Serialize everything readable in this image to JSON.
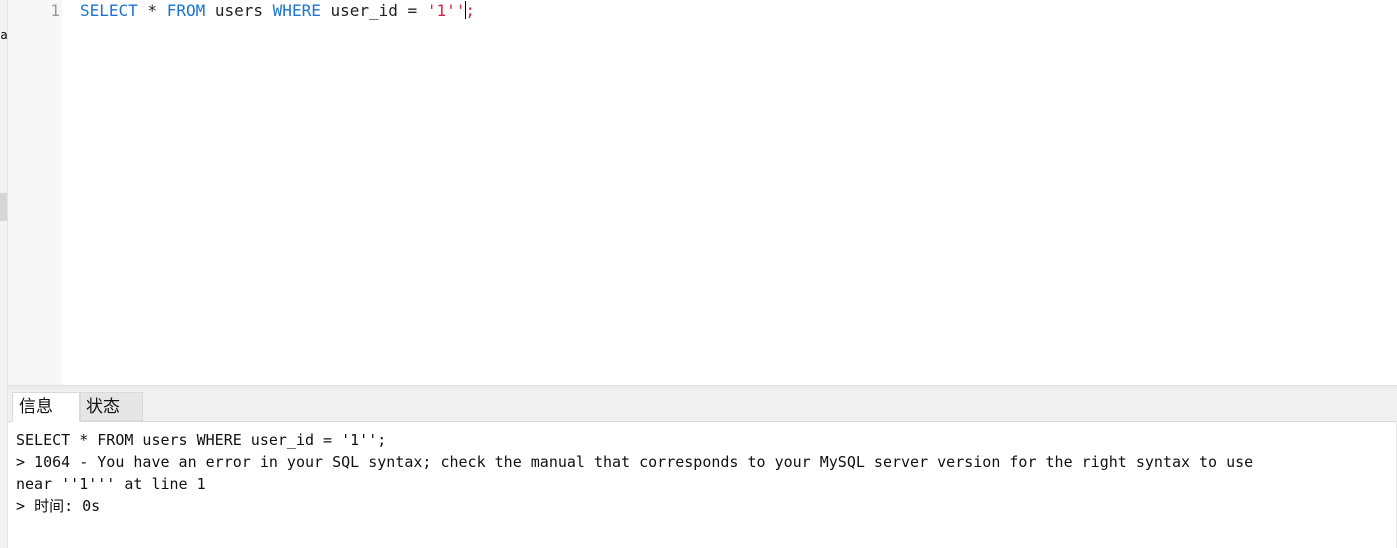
{
  "sidebar": {
    "fragment": "la"
  },
  "editor": {
    "line_number": "1",
    "tokens": {
      "kw_select": "SELECT",
      "star": " * ",
      "kw_from": "FROM",
      "table": " users ",
      "kw_where": "WHERE",
      "condition": " user_id = ",
      "string": "'1''",
      "semicolon": ";"
    }
  },
  "results": {
    "tabs": [
      {
        "label": "信息",
        "active": true
      },
      {
        "label": "状态",
        "active": false
      }
    ],
    "lines": {
      "query": "SELECT * FROM users WHERE user_id = '1'';",
      "error_line1": "> 1064 - You have an error in your SQL syntax; check the manual that corresponds to your MySQL server version for the right syntax to use",
      "error_line2": "near ''1''' at line 1",
      "time_prefix": "> ",
      "time_label": "时间",
      "time_value": ": 0s"
    }
  },
  "colors": {
    "keyword": "#1a73d6",
    "string": "#e0203c",
    "gutter_bg": "#f7f7f7",
    "line_number": "#999999"
  }
}
